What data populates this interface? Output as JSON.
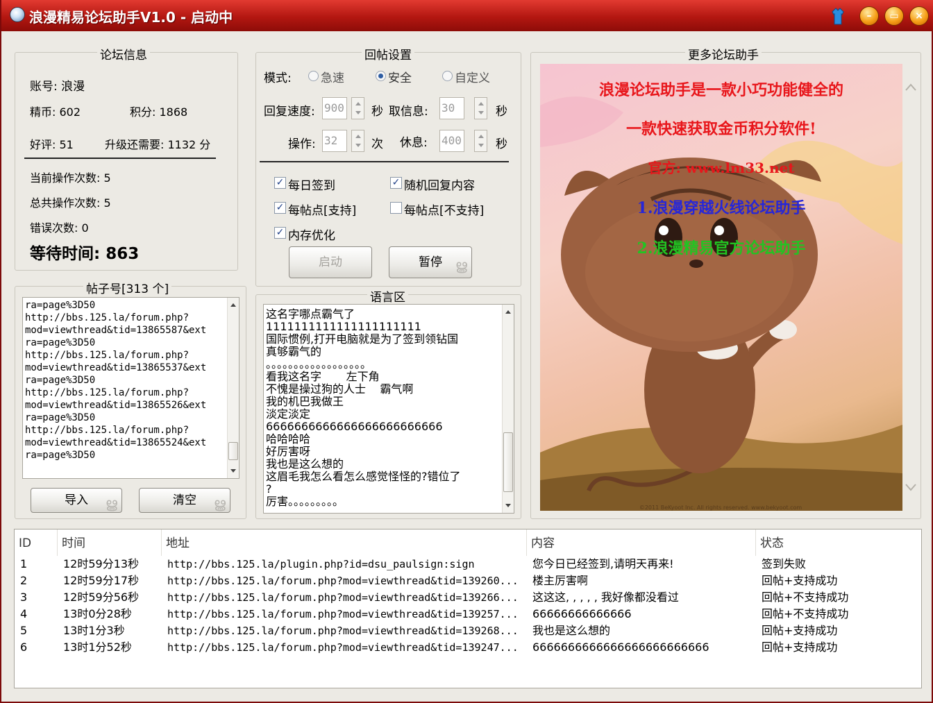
{
  "window": {
    "title": "浪漫精易论坛助手V1.0 - 启动中"
  },
  "forum_info": {
    "title": "论坛信息",
    "account": "账号: 浪漫",
    "gold": "精币: 602",
    "points": "积分: 1868",
    "rating": "好评: 51",
    "upgrade": "升级还需要: 1132 分",
    "current_ops": "当前操作次数: 5",
    "total_ops": "总共操作次数: 5",
    "errors": "错误次数: 0",
    "wait_time": "等待时间: 863"
  },
  "post_list": {
    "title": "帖子号[313 个]",
    "lines": [
      "ra=page%3D50",
      "http://bbs.125.la/forum.php?",
      "mod=viewthread&tid=13865587&ext",
      "ra=page%3D50",
      "http://bbs.125.la/forum.php?",
      "mod=viewthread&tid=13865537&ext",
      "ra=page%3D50",
      "http://bbs.125.la/forum.php?",
      "mod=viewthread&tid=13865526&ext",
      "ra=page%3D50",
      "http://bbs.125.la/forum.php?",
      "mod=viewthread&tid=13865524&ext",
      "ra=page%3D50"
    ],
    "import_label": "导入",
    "clear_label": "清空"
  },
  "reply_settings": {
    "title": "回帖设置",
    "mode_label": "模式:",
    "modes": [
      "急速",
      "安全",
      "自定义"
    ],
    "selected_mode": "安全",
    "reply_speed_label": "回复速度:",
    "reply_speed_value": "900",
    "unit_sec": "秒",
    "fetch_info_label": "取信息:",
    "fetch_info_value": "30",
    "operations_label": "操作:",
    "operations_value": "32",
    "unit_times": "次",
    "rest_label": "休息:",
    "rest_value": "400",
    "checkboxes": [
      {
        "label": "每日签到",
        "checked": true
      },
      {
        "label": "随机回复内容",
        "checked": true
      },
      {
        "label": "每帖点[支持]",
        "checked": true
      },
      {
        "label": "每帖点[不支持]",
        "checked": false
      },
      {
        "label": "内存优化",
        "checked": true
      }
    ],
    "check_mark": "✓",
    "start_label": "启动",
    "pause_label": "暂停"
  },
  "language_area": {
    "title": "语言区",
    "lines": [
      "这名字哪点霸气了",
      "1111111111111111111111",
      "国际惯例,打开电脑就是为了签到领钻国",
      "真够霸气的",
      "。。。。。。。。。。。。。。。。。。",
      "看我这名字       左下角",
      "不愧是操过狗的人士    霸气啊",
      "我的机巴我做王",
      "淡定淡定",
      "6666666666666666666666666",
      "哈哈哈哈",
      "好厉害呀",
      "我也是这么想的",
      "这眉毛我怎么看怎么感觉怪怪的?错位了",
      "?",
      "厉害。。。。。。。。。"
    ]
  },
  "more_helpers": {
    "title": "更多论坛助手",
    "line1": "浪漫论坛助手是一款小巧功能健全的",
    "line2": "一款快速获取金币积分软件!",
    "line3": "官方: www.lm33.net",
    "line4": "1.浪漫穿越火线论坛助手",
    "line5": "2.浪漫精易官方论坛助手",
    "copyright": "©2011 BeKyoot Inc.  All rights reserved.  www.bekyoot.com",
    "colors": {
      "red": "#e8161b",
      "blue": "#2626d8",
      "green": "#22c422"
    }
  },
  "log_table": {
    "columns": [
      "ID",
      "时间",
      "地址",
      "内容",
      "状态"
    ],
    "rows": [
      {
        "id": "1",
        "time": "12时59分13秒",
        "url": "http://bbs.125.la/plugin.php?id=dsu_paulsign:sign",
        "content": "您今日已经签到,请明天再来!",
        "status": "签到失败"
      },
      {
        "id": "2",
        "time": "12时59分17秒",
        "url": "http://bbs.125.la/forum.php?mod=viewthread&tid=139260...",
        "content": "楼主厉害啊",
        "status": "回帖+支持成功"
      },
      {
        "id": "3",
        "time": "12时59分56秒",
        "url": "http://bbs.125.la/forum.php?mod=viewthread&tid=139266...",
        "content": "这这这, , , , , 我好像都没看过",
        "status": "回帖+不支持成功"
      },
      {
        "id": "4",
        "time": "13时0分28秒",
        "url": "http://bbs.125.la/forum.php?mod=viewthread&tid=139257...",
        "content": "66666666666666",
        "status": "回帖+不支持成功"
      },
      {
        "id": "5",
        "time": "13时1分3秒",
        "url": "http://bbs.125.la/forum.php?mod=viewthread&tid=139268...",
        "content": "我也是这么想的",
        "status": "回帖+支持成功"
      },
      {
        "id": "6",
        "time": "13时1分52秒",
        "url": "http://bbs.125.la/forum.php?mod=viewthread&tid=139247...",
        "content": "6666666666666666666666666",
        "status": "回帖+支持成功"
      }
    ]
  }
}
